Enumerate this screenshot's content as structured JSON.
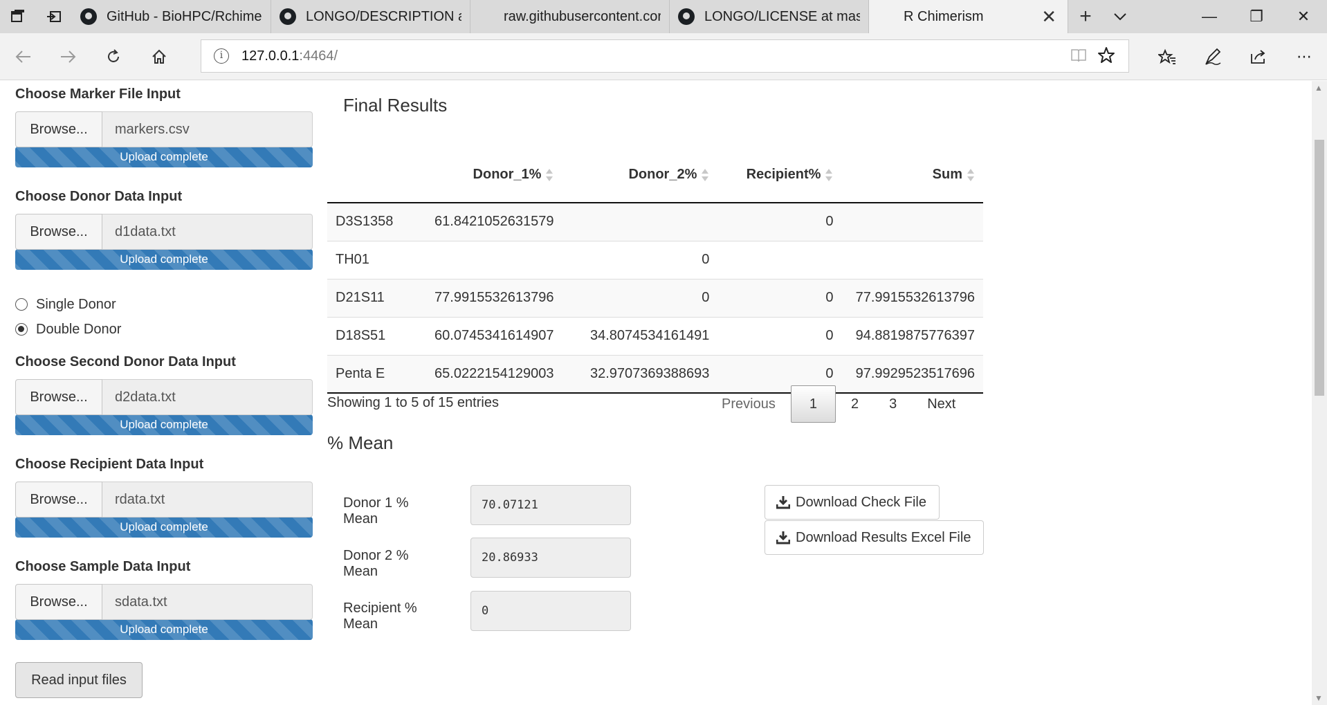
{
  "browser": {
    "tabs": [
      {
        "label": "GitHub - BioHPC/Rchimeri",
        "icon": "github-icon"
      },
      {
        "label": "LONGO/DESCRIPTION at r",
        "icon": "github-icon"
      },
      {
        "label": "raw.githubusercontent.cor",
        "icon": ""
      },
      {
        "label": "LONGO/LICENSE at maste",
        "icon": "github-icon"
      }
    ],
    "active_tab": "R Chimerism",
    "url_host": "127.0.0.1",
    "url_rest": ":4464/"
  },
  "sidebar": {
    "browse_label": "Browse...",
    "upload_status": "Upload complete",
    "file_inputs": [
      {
        "label": "Choose Marker File Input",
        "file": "markers.csv"
      },
      {
        "label": "Choose Donor Data Input",
        "file": "d1data.txt"
      },
      {
        "label": "Choose Second Donor Data Input",
        "file": "d2data.txt"
      },
      {
        "label": "Choose Recipient Data Input",
        "file": "rdata.txt"
      },
      {
        "label": "Choose Sample Data Input",
        "file": "sdata.txt"
      }
    ],
    "radio_options": [
      {
        "label": "Single Donor",
        "checked": false
      },
      {
        "label": "Double Donor",
        "checked": true
      }
    ],
    "read_button": "Read input files"
  },
  "results": {
    "title": "Final Results",
    "columns": [
      "",
      "Donor_1%",
      "Donor_2%",
      "Recipient%",
      "Sum"
    ],
    "rows": [
      [
        "D3S1358",
        "61.8421052631579",
        "",
        "0",
        ""
      ],
      [
        "TH01",
        "",
        "0",
        "",
        ""
      ],
      [
        "D21S11",
        "77.9915532613796",
        "0",
        "0",
        "77.9915532613796"
      ],
      [
        "D18S51",
        "60.0745341614907",
        "34.8074534161491",
        "0",
        "94.8819875776397"
      ],
      [
        "Penta E",
        "65.0222154129003",
        "32.9707369388693",
        "0",
        "97.9929523517696"
      ]
    ],
    "info": "Showing 1 to 5 of 15 entries",
    "pager": {
      "previous": "Previous",
      "pages": [
        "1",
        "2",
        "3"
      ],
      "current": "1",
      "next": "Next"
    }
  },
  "mean": {
    "title": "% Mean",
    "fields": [
      {
        "label": "Donor 1 % Mean",
        "value": "70.07121"
      },
      {
        "label": "Donor 2 % Mean",
        "value": "20.86933"
      },
      {
        "label": "Recipient % Mean",
        "value": "0"
      }
    ],
    "download_check": "Download Check File",
    "download_excel": "Download Results Excel File"
  },
  "colors": {
    "progress": "#337ab7",
    "tab_bar": "#dadada",
    "toolbar": "#f2f2f2"
  }
}
